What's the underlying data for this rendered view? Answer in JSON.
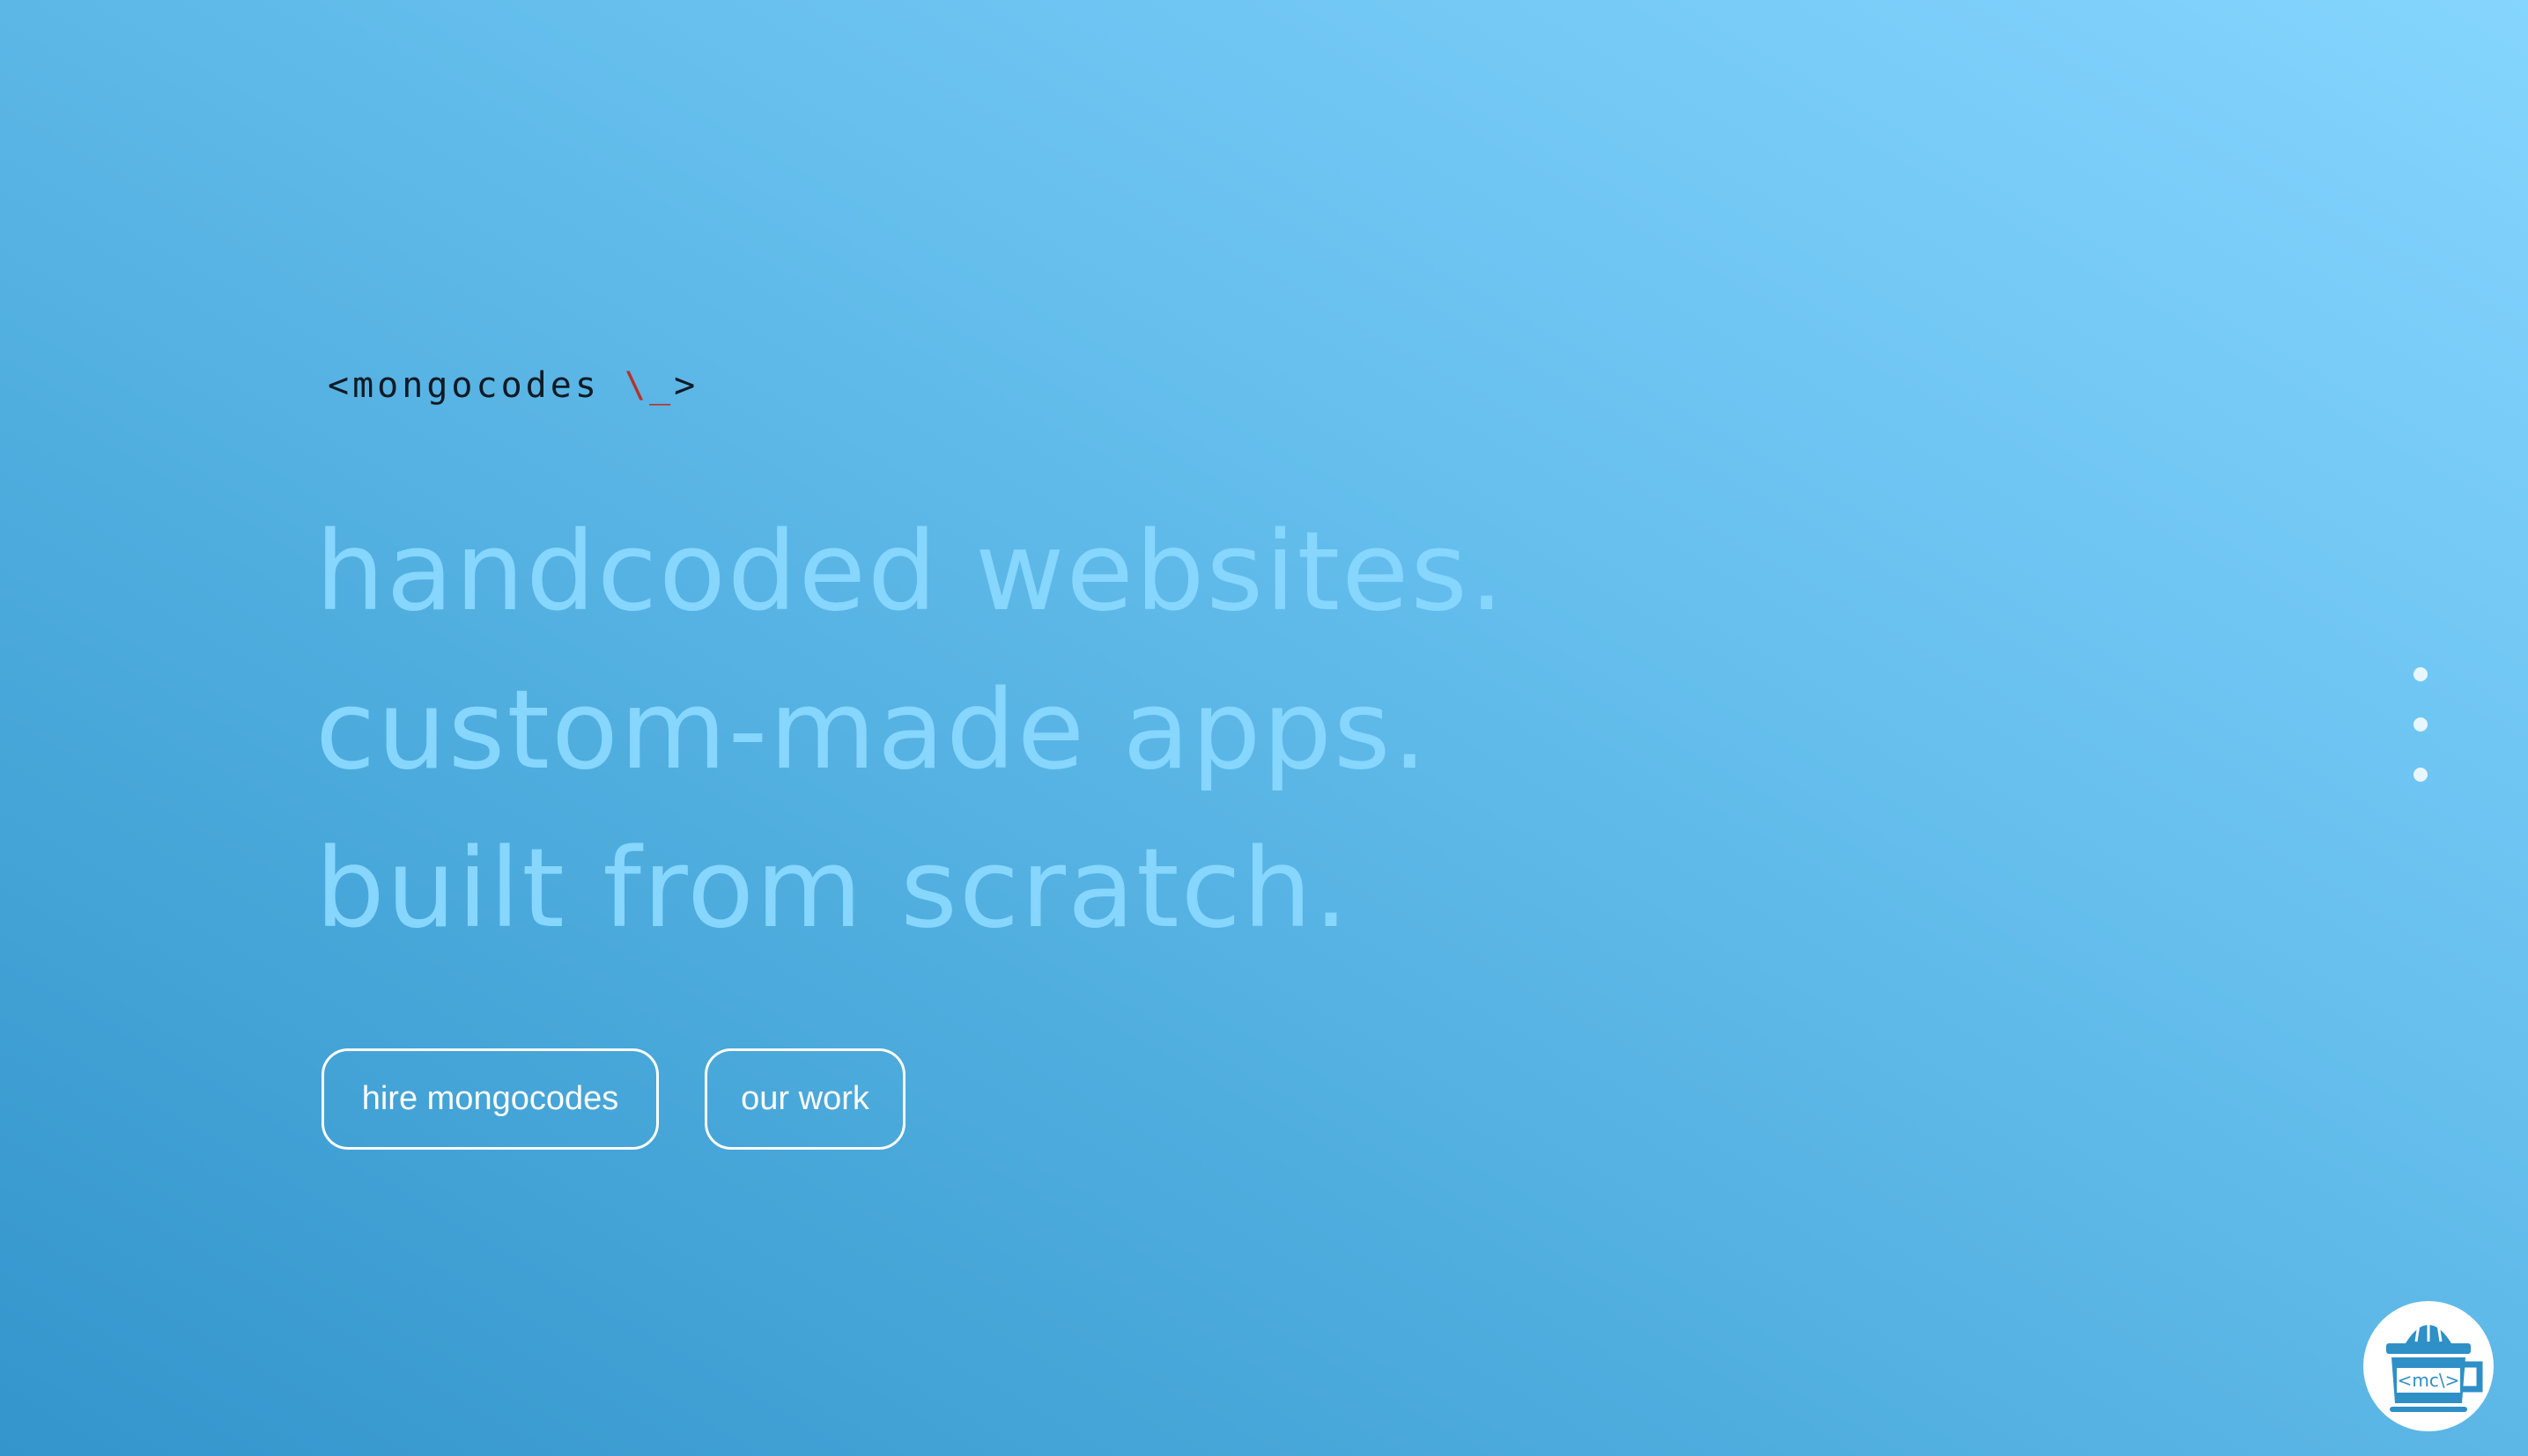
{
  "brand": {
    "prefix": "<mongocodes ",
    "accent": "\\_",
    "suffix": ">",
    "accent_color": "#b73226"
  },
  "hero": {
    "lines": [
      "handcoded websites.",
      "custom-made apps.",
      "built from scratch."
    ],
    "text_color": "#86d6fd"
  },
  "actions": {
    "hire_label": "hire mongocodes",
    "work_label": "our work"
  },
  "menu": {
    "icon": "vertical-ellipsis-icon"
  },
  "badge": {
    "icon": "coffee-mug-icon",
    "label": "<mc\\>",
    "color": "#2f8fc7"
  },
  "colors": {
    "gradient_start": "#3395cc",
    "gradient_end": "#85d5fe"
  }
}
